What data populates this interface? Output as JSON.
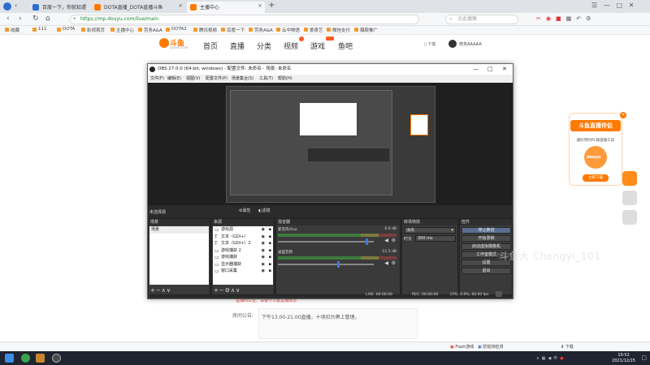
{
  "browser": {
    "tabs": [
      {
        "label": "百度一下，你就知道",
        "active": false
      },
      {
        "label": "DOTA直播_DOTA直播斗鱼",
        "active": false
      },
      {
        "label": "主播中心",
        "active": true
      }
    ],
    "url": "https://mp.douyu.com/live/main",
    "search_placeholder": "点此搜索",
    "bookmarks": [
      "收藏",
      "111",
      "DOTA",
      "影视首页",
      "主播中心",
      "劳务A&A",
      "DOTA2",
      "腾讯视频",
      "百度一下",
      "劳务A&A",
      "云中物语",
      "爱奇艺",
      "微信支付",
      "爆款推广"
    ],
    "status_items": [
      "Flash游戏",
      "防劫持检测",
      "下载"
    ]
  },
  "site": {
    "logo_text": "斗鱼",
    "logo_sub": "DOUYU.COM",
    "nav": [
      "首页",
      "直播",
      "分类",
      "视频",
      "游戏",
      "鱼吧"
    ],
    "download_label": "下载",
    "username": "劳务AAAAA",
    "notice_red": "直播间公告：请遵守斗鱼直播规范",
    "announce_label": "房间公告:",
    "announce_text": "下午13.00-21.00直播，十项扣台牌上管理。",
    "ad_title": "斗鱼直播伴侣",
    "ad_sub": "最好用的PC端直播工具",
    "ad_badge": "douyu",
    "ad_button": "立即下载",
    "watermark": "斗鱼大 Chengyi_101"
  },
  "obs": {
    "title": "OBS 27.0.0 (64-bit, windows) - 配置文件: 未命名 - 场景: 未命名",
    "menu": [
      "文件(F)",
      "编辑(E)",
      "视图(V)",
      "配置文件(P)",
      "场景集合(S)",
      "工具(T)",
      "帮助(H)"
    ],
    "source_label": "未选择源",
    "props_btn": "属性",
    "filters_btn": "滤镜",
    "panels": {
      "scenes": "场景",
      "sources": "来源",
      "mixer": "混音器",
      "transitions": "转场特效",
      "controls": "控件"
    },
    "scenes": [
      "场景"
    ],
    "sources": [
      {
        "icon": "game-icon",
        "glyph": "▭",
        "name": "游戏源"
      },
      {
        "icon": "text-icon",
        "glyph": "T",
        "name": "文本（GDI+）"
      },
      {
        "icon": "text-icon",
        "glyph": "T",
        "name": "文本（GDI+）2"
      },
      {
        "icon": "window-icon",
        "glyph": "▭",
        "name": "游戏捕获 2"
      },
      {
        "icon": "window-icon",
        "glyph": "▭",
        "name": "游戏捕获"
      },
      {
        "icon": "monitor-icon",
        "glyph": "▭",
        "name": "显示器捕获"
      },
      {
        "icon": "window-icon",
        "glyph": "▭",
        "name": "窗口采集"
      }
    ],
    "mixer": [
      {
        "name": "麦克风/Aux",
        "db": "0.0 dB",
        "level": 0.92
      },
      {
        "name": "桌面音频",
        "db": "-11.5 dB",
        "level": 0.63
      }
    ],
    "transitions": {
      "type": "淡出",
      "duration_label": "时长",
      "duration": "300 ms"
    },
    "controls": [
      "停止推流",
      "开始录制",
      "启动虚拟摄像机",
      "工作室模式",
      "设置",
      "退出"
    ],
    "controls_active": 0,
    "status": {
      "live": "LIVE: 00:00:00",
      "rec": "REC: 00:00:00",
      "cpu": "CPU: 0.9%, 60.00 fps"
    }
  },
  "taskbar": {
    "time": "10:52",
    "date": "2021/12/15"
  },
  "colors": {
    "accent": "#ff7a00",
    "obs_bg": "#2b2b2b"
  }
}
